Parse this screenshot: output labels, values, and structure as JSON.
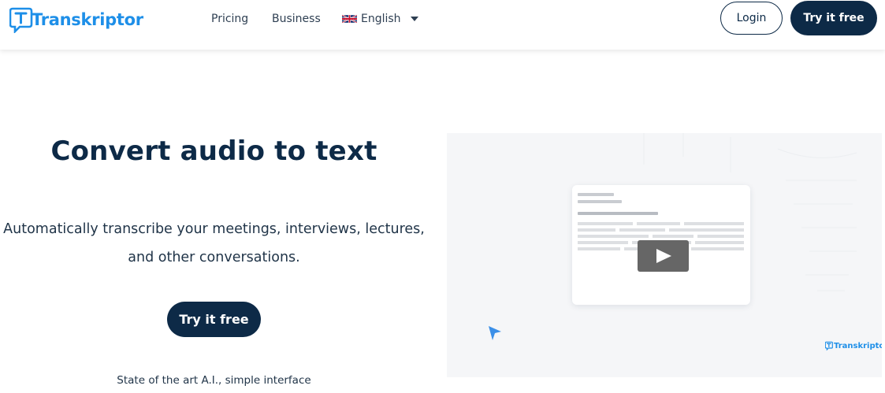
{
  "brand": {
    "name": "Transkriptor",
    "color": "#1e8fe8"
  },
  "nav": {
    "pricing": "Pricing",
    "business": "Business",
    "language": {
      "label": "English",
      "flag_icon": "uk-flag-icon"
    }
  },
  "header_actions": {
    "login": "Login",
    "try_free": "Try it free"
  },
  "hero": {
    "title": "Convert audio to text",
    "subtitle_line1": "Automatically transcribe your meetings, interviews, lectures,",
    "subtitle_line2": "and other conversations.",
    "cta": "Try it free",
    "tagline": "State of the art A.I., simple interface"
  },
  "video_preview": {
    "logo_text": "Transkriptor",
    "icons": [
      "play-icon",
      "pointer-cursor-icon"
    ]
  },
  "colors": {
    "primary_dark": "#0d2a47",
    "accent_blue": "#1e8fe8",
    "play_button": "#666666"
  }
}
